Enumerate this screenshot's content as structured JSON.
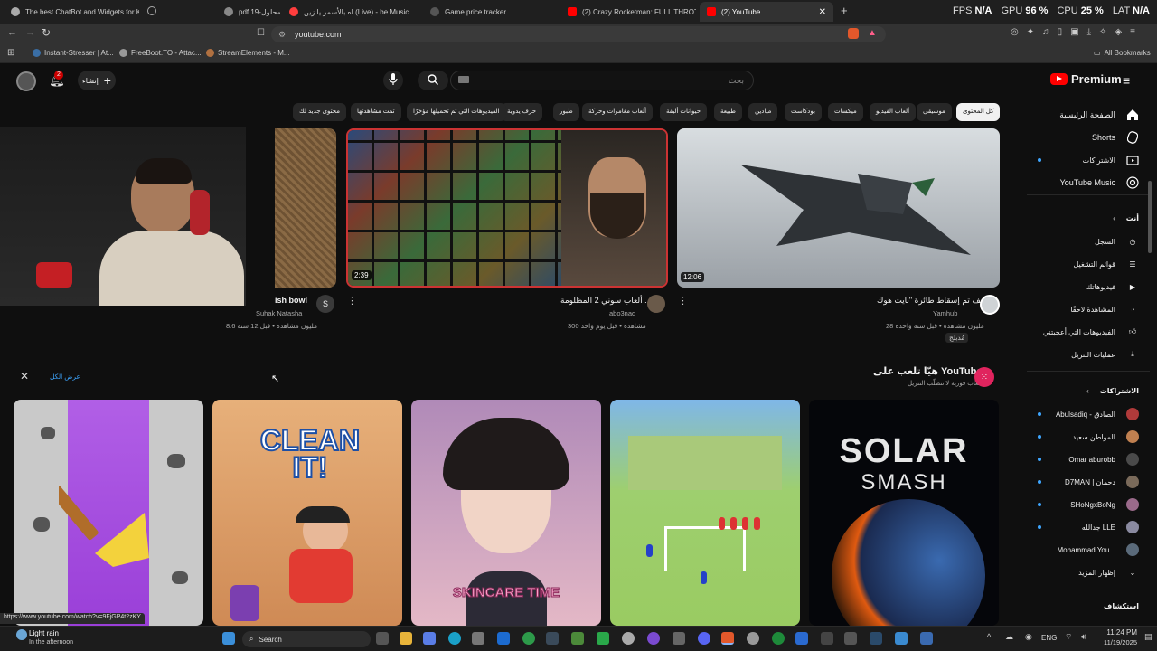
{
  "browser": {
    "tabs": [
      {
        "label": "The best ChatBot and Widgets for Ki"
      },
      {
        "label": "pdf.محلول-19"
      },
      {
        "label": "اه بالأسمر يا زين (Live) - be Music"
      },
      {
        "label": "Game price tracker"
      },
      {
        "label": "(2) Crazy Rocketman: FULL THROTTL"
      },
      {
        "label": "(2) YouTube"
      }
    ],
    "stats": {
      "fps_label": "FPS",
      "fps_value": "N/A",
      "gpu_label": "GPU",
      "gpu_value": "96 %",
      "cpu_label": "CPU",
      "cpu_value": "25 %",
      "lat_label": "LAT",
      "lat_value": "N/A"
    },
    "url": "youtube.com",
    "bookmarks": [
      {
        "label": "Instant-Stresser | At..."
      },
      {
        "label": "FreeBoot.TO - Attac..."
      },
      {
        "label": "StreamElements - M..."
      }
    ],
    "all_bookmarks": "All Bookmarks"
  },
  "youtube": {
    "logo": "Premium",
    "search_placeholder": "بحث",
    "create_label": "إنشاء",
    "notif_count": "2",
    "chips": [
      {
        "label": "كل المحتوى"
      },
      {
        "label": "موسيقى"
      },
      {
        "label": "ألعاب الفيديو"
      },
      {
        "label": "ميكسات"
      },
      {
        "label": "بودكاست"
      },
      {
        "label": "ميادين"
      },
      {
        "label": "طبيعة"
      },
      {
        "label": "حيوانات أليفة"
      },
      {
        "label": "ألعاب مغامرات وحركة"
      },
      {
        "label": "طبور"
      },
      {
        "label": "حرف يدوية"
      },
      {
        "label": "الفيديوهات التي تم تحميلها مؤخرًا"
      },
      {
        "label": "تمت مشاهدتها"
      },
      {
        "label": "محتوى جديد لك"
      }
    ],
    "sidebar": {
      "main": [
        {
          "label": "الصفحة الرئيسية",
          "icon": "home-icon"
        },
        {
          "label": "Shorts",
          "icon": "shorts-icon"
        },
        {
          "label": "الاشتراكات",
          "icon": "subscriptions-icon"
        },
        {
          "label": "YouTube Music",
          "icon": "music-icon"
        }
      ],
      "you_heading": "أنت",
      "you": [
        {
          "label": "السجل",
          "icon": "history-icon"
        },
        {
          "label": "قوائم التشغيل",
          "icon": "playlist-icon"
        },
        {
          "label": "فيديوهاتك",
          "icon": "video-icon"
        },
        {
          "label": "المشاهدة لاحقًا",
          "icon": "clock-icon"
        },
        {
          "label": "الفيديوهات التي أعجبتني",
          "icon": "like-icon"
        },
        {
          "label": "عمليات التنزيل",
          "icon": "download-icon"
        }
      ],
      "subs_heading": "الاشتراكات",
      "subs": [
        {
          "label": "Abulsadiq - الصادق",
          "color": "#b03a3a"
        },
        {
          "label": "المواطن سعيد",
          "color": "#c08050"
        },
        {
          "label": "Omar aburobb",
          "color": "#4a4a4a"
        },
        {
          "label": "D7MAN | دحمان",
          "color": "#7a6a5a"
        },
        {
          "label": "SHoNgxBoNg",
          "color": "#9a6a8a"
        },
        {
          "label": "جدالله LLE",
          "color": "#8a8aa0"
        },
        {
          "label": "Mohammad You...",
          "color": "#5a6a7a"
        }
      ],
      "show_more": "إظهار المزيد",
      "explore": "استكشاف"
    },
    "videos": [
      {
        "title": "ish bowl",
        "channel": "Suhak Natasha",
        "meta": "8.6 مليون مشاهدة • قبل 12 سنة",
        "avatar_letter": "S"
      },
      {
        "title": "ألعاب سوني 2 المظلومة ..",
        "channel": "abo3nad",
        "meta": "300 مشاهدة • قبل يوم واحد",
        "duration": "2:39"
      },
      {
        "title": "كيف تم إسقاط طائرة \"نايت هوك\"",
        "channel": "Yamhub",
        "meta": "28 مليون مشاهدة • قبل سنة واحدة",
        "badge": "مُدبلج",
        "duration": "12:06"
      }
    ],
    "games_section": {
      "title": "هيّا تلعب على YouTube",
      "subtitle": "ألعاب فورية لا تتطلّب التنزيل",
      "show_all": "عرض الكل",
      "games": [
        {
          "name": "Paint roller"
        },
        {
          "name": "CLEAN IT!"
        },
        {
          "name": "SKINCARE TIME"
        },
        {
          "name": "Soccer"
        },
        {
          "name_top": "SOLAR",
          "name_bottom": "SMASH"
        }
      ]
    },
    "status_url": "https://www.youtube.com/watch?v=9FjGP4t2zKY"
  },
  "taskbar": {
    "weather": "Light rain",
    "weather_sub": "In the afternoon",
    "search": "Search",
    "lang": "ENG",
    "time": "11:24 PM",
    "date": "11/19/2025"
  }
}
